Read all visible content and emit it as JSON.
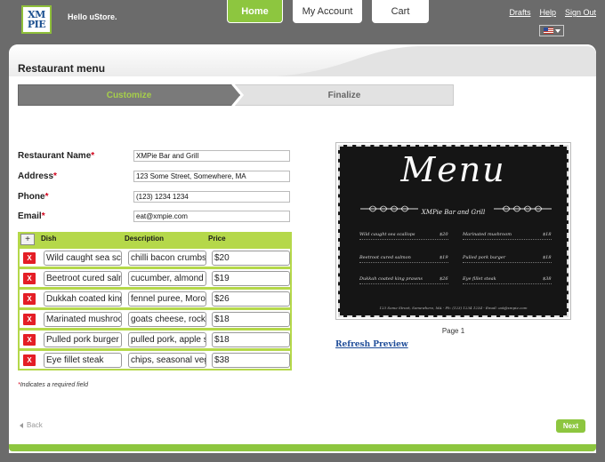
{
  "header": {
    "logo_top": "XM",
    "logo_bottom": "PIE",
    "greeting": "Hello uStore.",
    "nav": {
      "home": "Home",
      "account": "My Account",
      "cart": "Cart"
    },
    "links": {
      "drafts": "Drafts",
      "help": "Help",
      "signout": "Sign Out"
    },
    "language_icon": "us-flag-icon"
  },
  "page": {
    "title": "Restaurant menu",
    "steps": {
      "active": "Customize",
      "next": "Finalize"
    }
  },
  "form": {
    "restaurant_name_label": "Restaurant Name",
    "restaurant_name_value": "XMPie Bar and Grill",
    "address_label": "Address",
    "address_value": "123 Some Street, Somewhere, MA",
    "phone_label": "Phone",
    "phone_value": "(123) 1234 1234",
    "email_label": "Email",
    "email_value": "eat@xmpie.com",
    "required_marker": "*"
  },
  "dishes": {
    "add_label": "+",
    "remove_label": "X",
    "columns": {
      "dish": "Dish",
      "description": "Description",
      "price": "Price"
    },
    "rows": [
      {
        "dish": "Wild caught sea scallops",
        "description": "chilli bacon crumbs, lemon",
        "price": "$20"
      },
      {
        "dish": "Beetroot cured salmon",
        "description": "cucumber, almond cream",
        "price": "$19"
      },
      {
        "dish": "Dukkah coated king prawns",
        "description": "fennel puree, Moroccan spice",
        "price": "$26"
      },
      {
        "dish": "Marinated mushrooms",
        "description": "goats cheese, rocket",
        "price": "$18"
      },
      {
        "dish": "Pulled pork burger",
        "description": "pulled pork, apple slaw",
        "price": "$18"
      },
      {
        "dish": "Eye fillet steak",
        "description": "chips, seasonal vegetables",
        "price": "$38"
      }
    ],
    "required_note": "Indicates a required field"
  },
  "preview": {
    "menu_word": "Menu",
    "restaurant": "XMPie Bar and Grill",
    "left_items": [
      {
        "name": "Wild caught sea scallops",
        "price": "$20"
      },
      {
        "name": "Beetroot cured salmon",
        "price": "$19"
      },
      {
        "name": "Dukkah coated king prawns",
        "price": "$26"
      }
    ],
    "right_items": [
      {
        "name": "Marinated mushroom",
        "price": "$18"
      },
      {
        "name": "Pulled pork burger",
        "price": "$18"
      },
      {
        "name": "Eye fillet steak",
        "price": "$38"
      }
    ],
    "footer": "123 Some Street, Somewhere, MA - Ph: (123) 1234 1234 - Email: eat@xmpie.com",
    "page_label": "Page 1",
    "refresh_label": "Refresh Preview"
  },
  "footer": {
    "back": "Back",
    "next": "Next"
  },
  "colors": {
    "accent": "#8dc63f",
    "header_bg": "#6b6b6b",
    "danger": "#e41e26",
    "link": "#1f4d99"
  }
}
